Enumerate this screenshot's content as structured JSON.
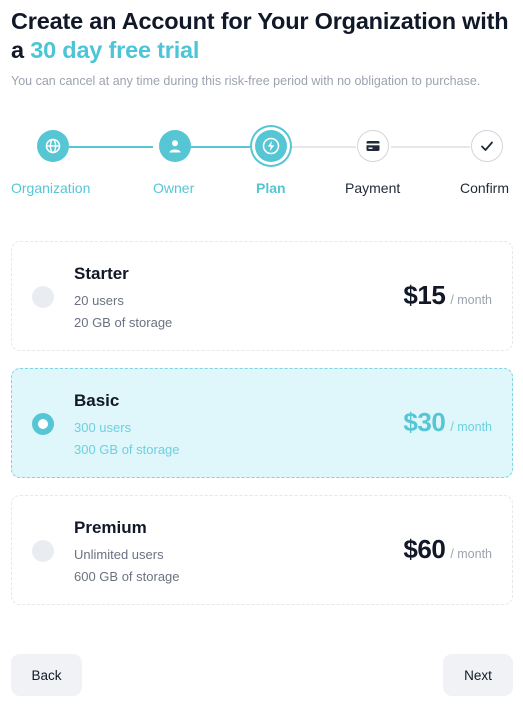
{
  "header": {
    "title_prefix": "Create an Account for Your Organization with a",
    "title_accent": "30 day free trial",
    "subtitle": "You can cancel at any time during this risk-free period with no obligation to purchase."
  },
  "steps": [
    {
      "label": "Organization",
      "icon": "globe-icon",
      "state": "done"
    },
    {
      "label": "Owner",
      "icon": "user-icon",
      "state": "done"
    },
    {
      "label": "Plan",
      "icon": "lightning-icon",
      "state": "active"
    },
    {
      "label": "Payment",
      "icon": "credit-card-icon",
      "state": "todo"
    },
    {
      "label": "Confirm",
      "icon": "check-icon",
      "state": "todo"
    }
  ],
  "plans": [
    {
      "name": "Starter",
      "line1": "20 users",
      "line2": "20 GB of storage",
      "price": "$15",
      "unit": "/ month",
      "selected": false
    },
    {
      "name": "Basic",
      "line1": "300 users",
      "line2": "300 GB of storage",
      "price": "$30",
      "unit": "/ month",
      "selected": true
    },
    {
      "name": "Premium",
      "line1": "Unlimited users",
      "line2": "600 GB of storage",
      "price": "$60",
      "unit": "/ month",
      "selected": false
    }
  ],
  "actions": {
    "back_label": "Back",
    "next_label": "Next"
  },
  "colors": {
    "accent": "#56c6d5",
    "selected_bg": "#dff6fb",
    "text": "#111827",
    "muted": "#9ca3af"
  }
}
